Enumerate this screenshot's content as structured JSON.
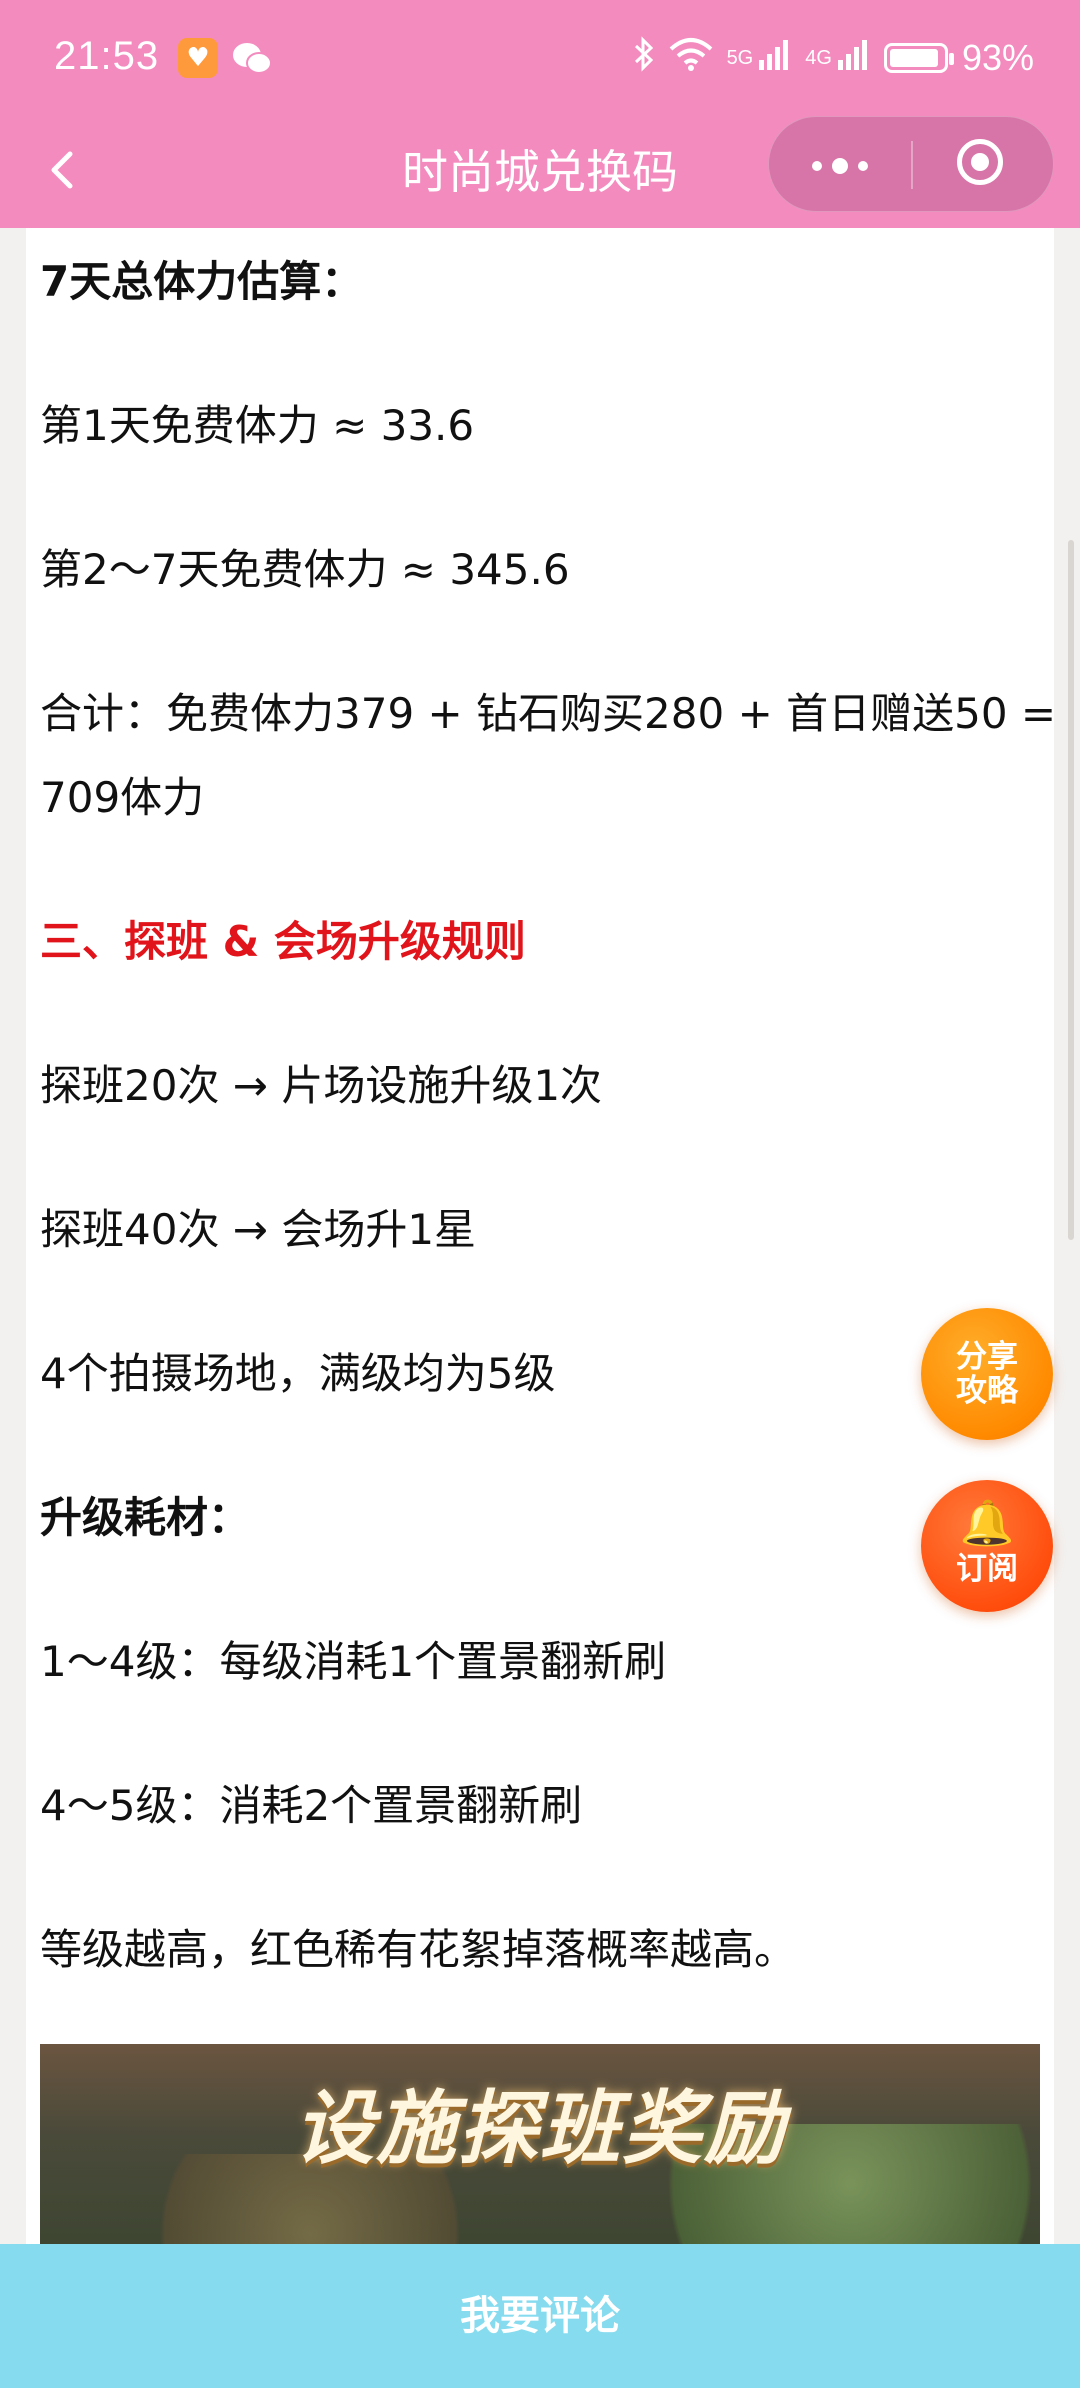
{
  "status_bar": {
    "time": "21:53",
    "battery": "93%",
    "battery_level": 0.93,
    "net_5g": "5G",
    "net_4g": "4G",
    "app_icon": "heart-app-icon",
    "chat_icon": "wechat-icon"
  },
  "nav": {
    "title": "时尚城兑换码",
    "back_icon": "chevron-left-icon",
    "more_icon": "more-dots-icon",
    "close_icon": "target-circle-icon"
  },
  "article": {
    "p1": "7天总体力估算：",
    "p2": "第1天免费体力 ≈ 33.6",
    "p3": "第2～7天免费体力 ≈ 345.6",
    "p4": "合计：免费体力379 + 钻石购买280 + 首日赠送50 = 709体力",
    "p5": "三、探班 & 会场升级规则",
    "p6": "探班20次 → 片场设施升级1次",
    "p7": "探班40次 → 会场升1星",
    "p8": "4个拍摄场地，满级均为5级",
    "p9": "升级耗材：",
    "p10": "1～4级：每级消耗1个置景翻新刷",
    "p11": "4～5级：消耗2个置景翻新刷",
    "p12": "等级越高，红色稀有花絮掉落概率越高。",
    "banner_title": "设施探班奖励"
  },
  "floating": {
    "share_label": "分享攻略",
    "subscribe_label": "订阅"
  },
  "comment_bar": {
    "label": "我要评论"
  },
  "colors": {
    "header_pink": "#f48bbf",
    "heading_red": "#e0141a",
    "comment_bar": "#86dbef",
    "share_orange": "#ff8a00",
    "subscribe_orange": "#ff4e0e"
  }
}
